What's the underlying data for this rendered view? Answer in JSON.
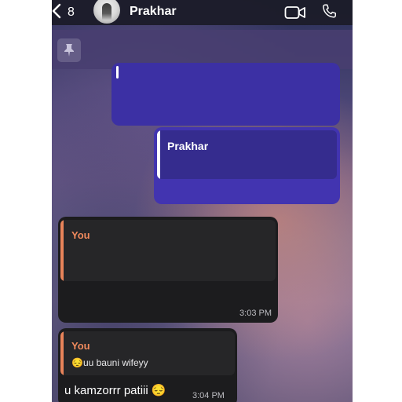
{
  "header": {
    "back_count": "8",
    "contact_name": "Prakhar",
    "icons": {
      "back": "chevron-left-icon",
      "video": "video-call-icon",
      "call": "phone-icon",
      "pin": "pin-icon"
    }
  },
  "messages": [
    {
      "direction": "outgoing",
      "reply_to": ""
    },
    {
      "direction": "outgoing",
      "reply_to": "Prakhar"
    },
    {
      "direction": "incoming",
      "reply_to": "You",
      "time": "3:03 PM"
    },
    {
      "direction": "incoming",
      "reply_to": "You",
      "quoted_text": "😔uu bauni wifeyy",
      "text": "u kamzorrr patiii 😔",
      "time": "3:04 PM"
    }
  ],
  "colors": {
    "outgoing_bubble": "#4234b0",
    "incoming_bubble": "#1c1c1e",
    "reply_accent": "#f08a5d"
  }
}
